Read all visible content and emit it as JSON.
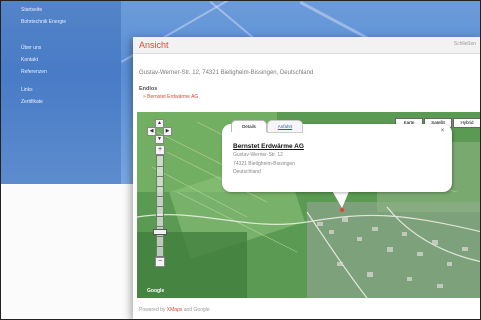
{
  "background": {
    "nav_items": [
      "Startseite",
      "Bohrtechnik Energie",
      "Über uns",
      "Kontakt",
      "Referenzen",
      "Links",
      "Zertifikate"
    ]
  },
  "popup": {
    "title": "Ansicht",
    "close_label": "Schließen",
    "address": "Gustav-Werner-Str. 12, 74321 Bietigheim-Bissingen, Deutschland",
    "links_heading": "Endlos",
    "link_item": "» Bernstet Erdwärme AG"
  },
  "map": {
    "map_types": [
      "Karte",
      "Satellit",
      "Hybrid"
    ],
    "info": {
      "tabs": [
        "Details",
        "Anfahrt"
      ],
      "name": "Bernstet Erdwärme AG",
      "street": "Gustav-Werner-Str. 12",
      "city": "74321 Bietigheim-Bissingen",
      "country": "Deutschland"
    },
    "google_label": "Google"
  },
  "footer": {
    "prefix": "Powered by ",
    "link": "XMaps",
    "suffix": " and Google"
  },
  "colors": {
    "accent": "#d94a3a",
    "map_green": "#5c9a55",
    "sky_blue": "#5a8fd6"
  }
}
